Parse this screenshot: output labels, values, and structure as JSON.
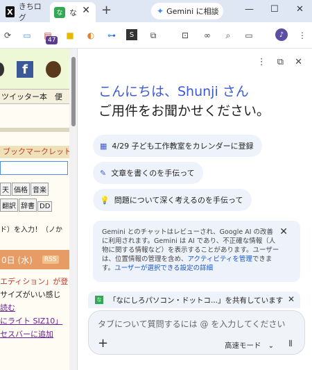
{
  "tabs": [
    {
      "label": "きちログ"
    },
    {
      "label": "な"
    }
  ],
  "gemini_button": "Gemini に相談",
  "toolbar": {
    "badge": "47"
  },
  "left_page": {
    "nav": "ツイッター本　便",
    "bookmark": "ブックマークレット >",
    "buttons": [
      "天",
      "価格",
      "音楽",
      "翻訳",
      "辞書",
      "DD"
    ],
    "hint": "ド）を入力！（ノか",
    "date": "0日 (水)",
    "rss": "RSS",
    "lines": [
      "エディション」が登",
      "サイズがいい感じ",
      "読む",
      "にライト SIZ10」",
      "セスバーに追加"
    ]
  },
  "gemini": {
    "greeting_name": "こんにちは、Shunji さん",
    "greeting_question": "ご用件をお聞かせください。",
    "chips": [
      {
        "icon": "calendar-plus-icon",
        "label": "4/29 子ども工作教室をカレンダーに登録"
      },
      {
        "icon": "pen-sparkle-icon",
        "label": "文章を書くのを手伝って"
      },
      {
        "icon": "lightbulb-icon",
        "label": "問題について深く考えるのを手伝って"
      }
    ],
    "notice_text": "Gemini とのチャットはレビューされ、Google AI の改善に利用されます。Gemini は AI であり、不正確な情報（人物に関する情報など）を表示することがあります。ユーザーは、位置情報の管理を含め、",
    "notice_link1": "アクティビティを管理",
    "notice_mid": "できます。",
    "notice_link2": "ユーザーが選択できる設定の詳細",
    "share_text": "「なにしろパソコン・ドットコ...」を共有しています",
    "input_placeholder": "タブについて質問するには @ を入力してください",
    "mode_label": "高速モード"
  }
}
